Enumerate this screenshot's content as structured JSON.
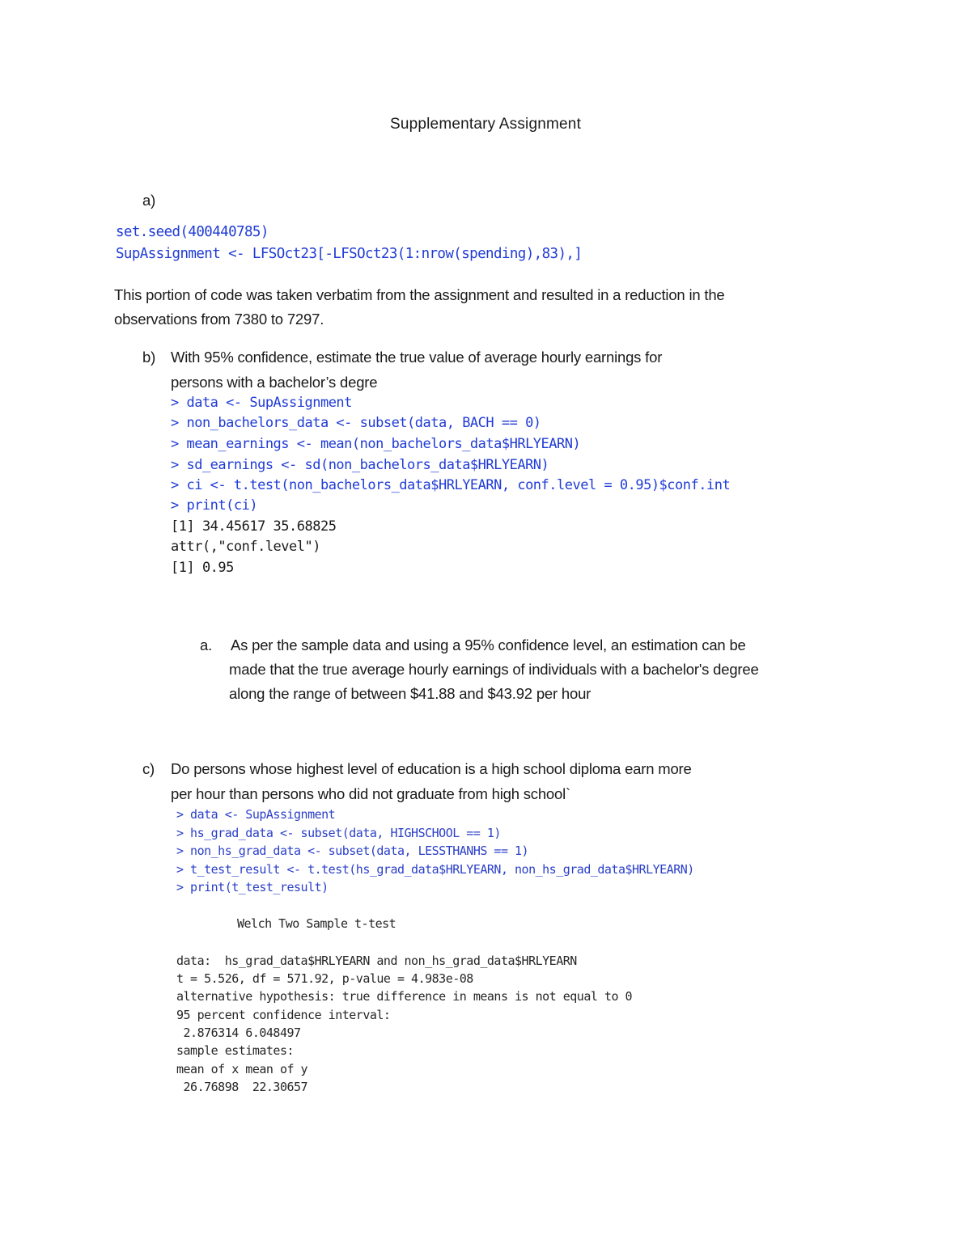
{
  "document": {
    "title": "Supplementary Assignment",
    "colors": {
      "code_blue": "#1f3bd6",
      "text": "#1a1a1a"
    },
    "section_a": {
      "label": "a)",
      "code_lines": [
        "set.seed(400440785)",
        "SupAssignment <- LFSOct23[-LFSOct23(1:nrow(spending),83),]"
      ],
      "explanation_lines": [
        "This portion of code was taken verbatim from the assignment and resulted in a reduction in the",
        "observations from 7380 to 7297."
      ]
    },
    "section_b": {
      "label": "b)",
      "question_lines": [
        "With 95% confidence, estimate the true value of average hourly earnings for",
        "persons with a bachelor’s degre"
      ],
      "code_input_lines": [
        "> data <- SupAssignment",
        "> non_bachelors_data <- subset(data, BACH == 0)",
        "> mean_earnings <- mean(non_bachelors_data$HRLYEARN)",
        "> sd_earnings <- sd(non_bachelors_data$HRLYEARN)",
        "> ci <- t.test(non_bachelors_data$HRLYEARN, conf.level = 0.95)$conf.int",
        "> print(ci)"
      ],
      "code_output_lines": [
        "[1] 34.45617 35.68825",
        "attr(,\"conf.level\")",
        "[1] 0.95"
      ],
      "answer": {
        "marker": "a.",
        "lines": [
          "As per the sample data and using a 95% confidence level, an estimation can be",
          "made that the true average hourly earnings of individuals with a bachelor's degree",
          "along the range of between $41.88 and $43.92 per hour"
        ]
      }
    },
    "section_c": {
      "label": "c)",
      "question_lines": [
        "Do persons whose highest level of education is a high school diploma earn more",
        "per hour than persons who did not graduate from high school`"
      ],
      "code_input_lines": [
        "> data <- SupAssignment",
        "> hs_grad_data <- subset(data, HIGHSCHOOL == 1)",
        "> non_hs_grad_data <- subset(data, LESSTHANHS == 1)",
        "> t_test_result <- t.test(hs_grad_data$HRLYEARN, non_hs_grad_data$HRLYEARN)",
        "> print(t_test_result)"
      ],
      "output_heading": "Welch Two Sample t-test",
      "code_output_lines": [
        "data:  hs_grad_data$HRLYEARN and non_hs_grad_data$HRLYEARN",
        "t = 5.526, df = 571.92, p-value = 4.983e-08",
        "alternative hypothesis: true difference in means is not equal to 0",
        "95 percent confidence interval:",
        " 2.876314 6.048497",
        "sample estimates:",
        "mean of x mean of y",
        " 26.76898  22.30657"
      ]
    }
  }
}
